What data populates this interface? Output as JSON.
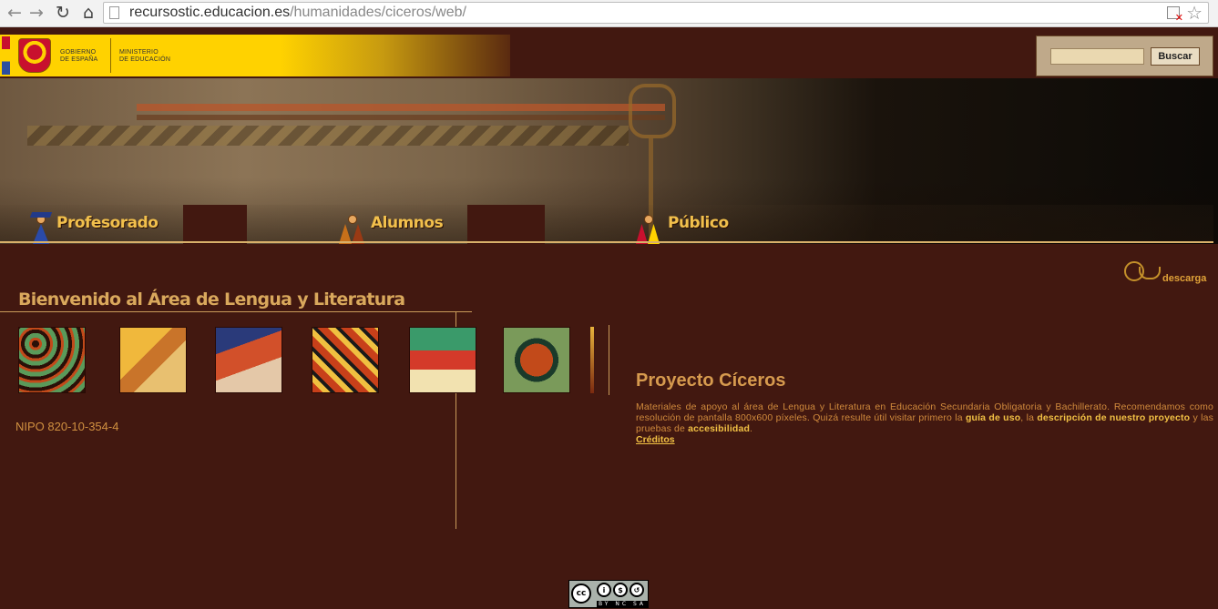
{
  "browser": {
    "url_host": "recursostic.educacion.es",
    "url_path": "/humanidades/ciceros/web/"
  },
  "header": {
    "gov_line1": "GOBIERNO",
    "gov_line2": "DE ESPAÑA",
    "ministry_line1": "MINISTERIO",
    "ministry_line2": "DE EDUCACIÓN",
    "search_button": "Buscar",
    "search_value": ""
  },
  "nav": {
    "items": [
      {
        "label": "Profesorado"
      },
      {
        "label": "Alumnos"
      },
      {
        "label": "Público"
      }
    ]
  },
  "download": {
    "label": "descarga"
  },
  "welcome": {
    "title": "Bienvenido al Área de Lengua y Literatura",
    "nipo": "NIPO 820-10-354-4"
  },
  "project": {
    "title": "Proyecto Cíceros",
    "desc_part1": "Materiales de apoyo al área de Lengua y Literatura en Educación Secundaria Obligatoria y Bachillerato. Recomendamos como resolución de pantalla 800x600 píxeles. Quizá  resulte útil visitar primero la ",
    "guide_link": "guía de uso",
    "desc_part2": ", la ",
    "project_link": "descripción de nuestro proyecto",
    "desc_part3": " y las pruebas de ",
    "access_link": "accesibilidad",
    "desc_part4": ".",
    "credits": "Créditos"
  },
  "license": {
    "cc": "cc",
    "band": "BY NC SA"
  },
  "colors": {
    "background": "#421810",
    "accent": "#f2c04c",
    "text": "#d08a3c"
  }
}
